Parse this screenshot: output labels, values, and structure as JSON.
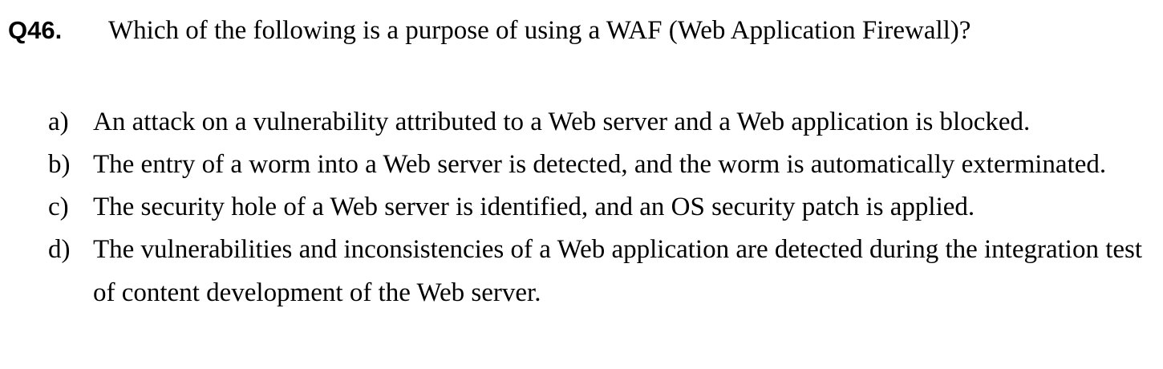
{
  "question": {
    "number": "Q46.",
    "text": "Which of the following is a purpose of using a WAF (Web Application Firewall)?"
  },
  "options": [
    {
      "label": "a)",
      "text": "An attack on a vulnerability attributed to a Web server and a Web application is blocked."
    },
    {
      "label": "b)",
      "text": "The entry of a worm into a Web server is detected, and the worm is automatically exterminated."
    },
    {
      "label": "c)",
      "text": "The security hole of a Web server is identified, and an OS security patch is applied."
    },
    {
      "label": "d)",
      "text": "The vulnerabilities and inconsistencies of a Web application are detected during the integration test of content development of the Web server."
    }
  ]
}
